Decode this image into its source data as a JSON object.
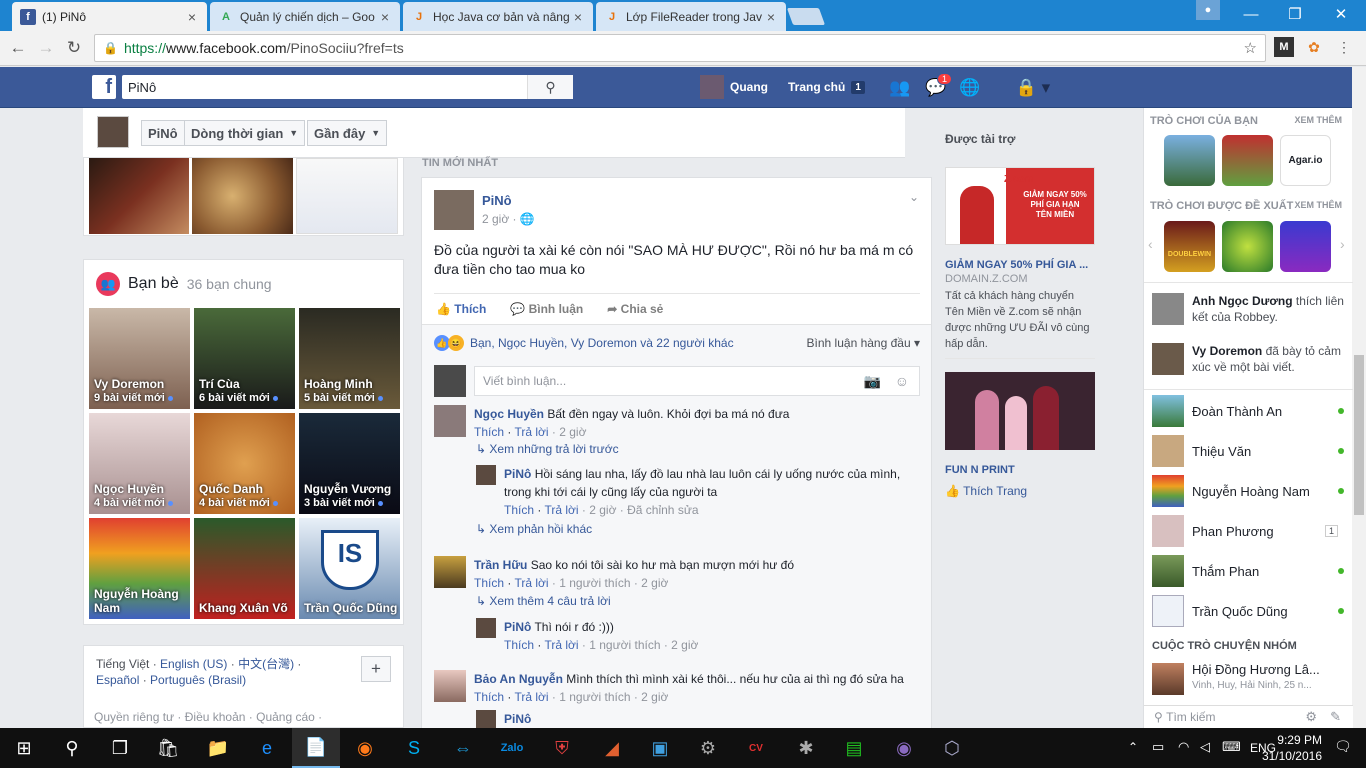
{
  "browser": {
    "tabs": [
      {
        "title": "(1) PiNô",
        "favicon": "f",
        "active": true
      },
      {
        "title": "Quản lý chiến dịch – Goo",
        "favicon": "A",
        "active": false
      },
      {
        "title": "Học Java cơ bản và nâng",
        "favicon": "J",
        "active": false
      },
      {
        "title": "Lớp FileReader trong Jav",
        "favicon": "J",
        "active": false
      }
    ],
    "url_protocol": "https://",
    "url_host": "www.facebook.com",
    "url_path": "/PinoSociiu?fref=ts"
  },
  "fb": {
    "search_value": "PiNô",
    "user_name": "Quang",
    "home_label": "Trang chủ",
    "home_count": "1",
    "messages_badge": "1"
  },
  "profile_bar": {
    "name": "PiNô",
    "timeline": "Dòng thời gian",
    "recent": "Gần đây"
  },
  "friends": {
    "title": "Bạn bè",
    "mutual": "36 bạn chung",
    "items": [
      {
        "name": "Vy Doremon",
        "sub": "9 bài viết mới"
      },
      {
        "name": "Trí Cùa",
        "sub": "6 bài viết mới"
      },
      {
        "name": "Hoàng Minh",
        "sub": "5 bài viết mới"
      },
      {
        "name": "Ngọc Huyền",
        "sub": "4 bài viết mới"
      },
      {
        "name": "Quốc Danh",
        "sub": "4 bài viết mới"
      },
      {
        "name": "Nguyễn Vương",
        "sub": "3 bài viết mới"
      },
      {
        "name": "Nguyễn Hoàng Nam",
        "sub": ""
      },
      {
        "name": "Khang Xuân Võ",
        "sub": ""
      },
      {
        "name": "Trần Quốc Dũng",
        "sub": ""
      }
    ]
  },
  "languages": {
    "current": "Tiếng Việt",
    "l1": "English (US)",
    "l2": "中文(台灣)",
    "l3": "Español",
    "l4": "Português (Brasil)"
  },
  "footer": "Quyền riêng tư · Điều khoản · Quảng cáo ·",
  "feed": {
    "section_label": "TIN MỚI NHẤT",
    "post": {
      "author": "PiNô",
      "time": "2 giờ",
      "text": "Đồ của người ta xài ké còn nói \"SAO MÀ HƯ ĐƯỢC\", Rồi nó hư ba má m có đưa tiền cho tao mua ko",
      "like": "Thích",
      "comment": "Bình luận",
      "share": "Chia sẻ",
      "reactors": "Bạn, Ngọc Huyền, Vy Doremon và 22 người khác",
      "sort": "Bình luận hàng đầu",
      "comment_placeholder": "Viết bình luận..."
    },
    "comments": [
      {
        "author": "Ngọc Huyền",
        "text": "Bất đền ngay và luôn. Khỏi đợi ba má nó đưa",
        "like": "Thích",
        "reply": "Trả lời",
        "meta": "· 2 giờ"
      },
      {
        "view_prev": "Xem những trả lời trước"
      },
      {
        "author": "PiNô",
        "text": "Hồi sáng lau nha, lấy đồ lau nhà lau luôn cái ly uống nước của mình, trong khi tới cái ly cũng lấy của người ta",
        "like": "Thích",
        "reply": "Trả lời",
        "meta": "· 2 giờ · Đã chỉnh sửa"
      },
      {
        "view_more": "Xem phản hồi khác"
      },
      {
        "author": "Trần Hữu",
        "text": "Sao ko nói tôi sài ko hư mà bạn mượn mới hư đó",
        "like": "Thích",
        "reply": "Trả lời",
        "meta": "· 1 người thích · 2 giờ"
      },
      {
        "view_more": "Xem thêm 4 câu trả lời"
      },
      {
        "author": "PiNô",
        "text": "Thì nói r đó :)))",
        "like": "Thích",
        "reply": "Trả lời",
        "meta": "· 1 người thích · 2 giờ"
      },
      {
        "author": "Bảo An Nguyễn",
        "text": "Mình thích thì mình xài ké thôi... nếu hư của ai thì ng đó sửa ha",
        "like": "Thích",
        "reply": "Trả lời",
        "meta": "· 1 người thích · 2 giờ"
      },
      {
        "author": "PiNô"
      }
    ]
  },
  "ads": {
    "heading": "Được tài trợ",
    "ad1_title": "GIẢM NGAY 50% PHÍ GIA ...",
    "ad1_domain": "DOMAIN.Z.COM",
    "ad1_body": "Tất cả khách hàng chuyển Tên Miền về Z.com sẽ nhận được những ƯU ĐÃI vô cùng hấp dẫn.",
    "ad1_banner_brand": "Z.com",
    "ad1_banner_text": "GIẢM NGAY 50% PHÍ GIA HẠN TÊN MIỀN",
    "ad2_title": "FUN N PRINT",
    "ad2_like": "Thích Trang"
  },
  "sidebar": {
    "games_title": "TRÒ CHƠI CỦA BẠN",
    "games_more": "XEM THÊM",
    "sugg_title": "TRÒ CHƠI ĐƯỢC ĐỀ XUẤT",
    "sugg_more": "XEM THÊM",
    "game_agar": "Agar.io",
    "game_doublewin": "DOUBLEWIN",
    "activity": [
      {
        "name": "Anh Ngọc Dương",
        "text": "thích liên kết của Robbey."
      },
      {
        "name": "Vy Doremon",
        "text": "đã bày tỏ cảm xúc về một bài viết."
      }
    ],
    "contacts": [
      {
        "name": "Đoàn Thành An",
        "online": true
      },
      {
        "name": "Thiệu Văn",
        "online": true
      },
      {
        "name": "Nguyễn Hoàng Nam",
        "online": true
      },
      {
        "name": "Phan Phương",
        "badge": "1"
      },
      {
        "name": "Thắm Phan",
        "online": true
      },
      {
        "name": "Trần Quốc Dũng",
        "online": true
      }
    ],
    "group_title": "CUỘC TRÒ CHUYỆN NHÓM",
    "group_name": "Hội Đồng Hương Lâ...",
    "group_members": "Vinh, Huy, Hải Ninh, 25 n...",
    "search_placeholder": "Tìm kiếm"
  },
  "taskbar": {
    "time": "9:29 PM",
    "date": "31/10/2016",
    "lang": "ENG"
  },
  "colors": {
    "fb_blue": "#3b5998",
    "link": "#365899",
    "online": "#42b72a",
    "chrome_tabbar": "#1e84d0"
  }
}
